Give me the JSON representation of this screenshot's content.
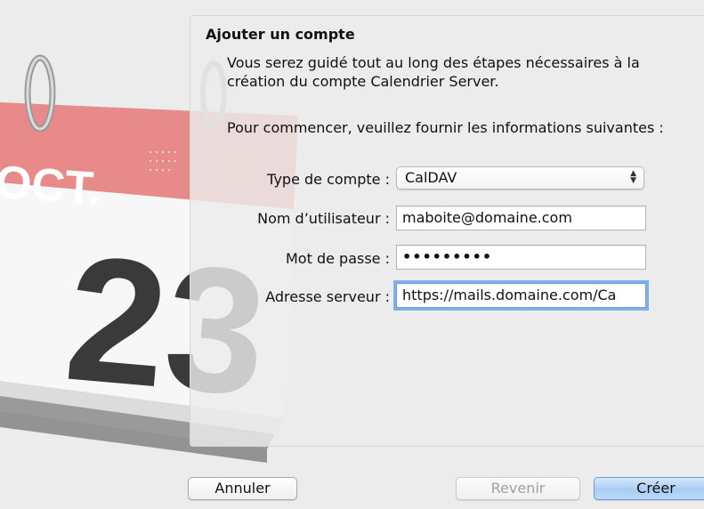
{
  "calendar_icon": {
    "month": "OCT.",
    "day": "23"
  },
  "dialog": {
    "title": "Ajouter un compte",
    "intro": "Vous serez guidé tout au long des étapes nécessaires à la création du compte Calendrier Server.",
    "prompt": "Pour commencer, veuillez fournir les informations suivantes :"
  },
  "form": {
    "account_type_label": "Type de compte :",
    "account_type_value": "CalDAV",
    "username_label": "Nom d’utilisateur :",
    "username_value": "maboite@domaine.com",
    "password_label": "Mot de passe :",
    "password_value": "•••••••••",
    "server_label": "Adresse serveur :",
    "server_value": "https://mails.domaine.com/Ca"
  },
  "buttons": {
    "cancel": "Annuler",
    "back": "Revenir",
    "create": "Créer"
  },
  "colors": {
    "calendar_red": "#e88a8a",
    "focus_ring": "#7fb0ea",
    "default_button": "#a9cdf5"
  }
}
